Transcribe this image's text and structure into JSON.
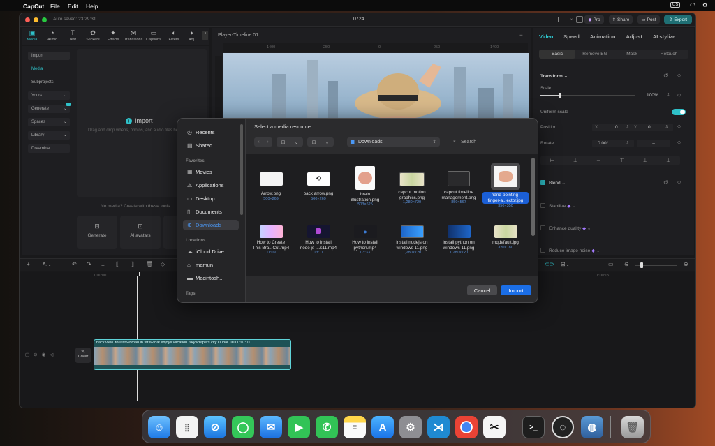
{
  "menubar": {
    "app": "CapCut",
    "items": [
      "File",
      "Edit",
      "Help"
    ],
    "input_source": "US"
  },
  "window": {
    "autosave": "Auto saved: 23:29:31",
    "title": "0724",
    "pro": "Pro",
    "share": "Share",
    "post": "Post",
    "export": "Export"
  },
  "toolbar": {
    "tools": [
      "Media",
      "Audio",
      "Text",
      "Stickers",
      "Effects",
      "Transitions",
      "Captions",
      "Filters",
      "Adj"
    ]
  },
  "leftnav": {
    "items": [
      "Import",
      "Media",
      "Subprojects",
      "Yours",
      "Generate",
      "Spaces",
      "Library",
      "Dreamina"
    ]
  },
  "media": {
    "import_label": "Import",
    "hint": "Drag and drop videos, photos, and audio files here",
    "no_media": "No media? Create with these tools",
    "generate": "Generate",
    "ai_avatars": "AI avatars"
  },
  "player": {
    "title": "Player-Timeline 01",
    "ruler": [
      "1400",
      "250",
      "0",
      "250",
      "1400"
    ]
  },
  "rightpanel": {
    "tabs": [
      "Video",
      "Speed",
      "Animation",
      "Adjust",
      "AI stylize"
    ],
    "subtabs": [
      "Basic",
      "Remove BG",
      "Mask",
      "Retouch"
    ],
    "transform": "Transform",
    "scale": "Scale",
    "scale_value": "100%",
    "uniform": "Uniform scale",
    "position": "Position",
    "pos_x_label": "X",
    "pos_x": "0",
    "pos_y_label": "Y",
    "pos_y": "0",
    "rotate": "Rotate",
    "rotate_value": "0.00°",
    "rotate_dash": "–",
    "blend": "Blend",
    "stabilize": "Stabilize",
    "enhance": "Enhance quality",
    "reduce_noise": "Reduce image noise"
  },
  "timeline": {
    "time_a": "1:00:00",
    "time_b": "1:00:15",
    "clip_label": "back view. tourist woman in straw hat enjoys vacation. skyscrapers city Dubai",
    "clip_time": "00:00:07:01",
    "cover": "Cover"
  },
  "dialog": {
    "title": "Select a media resource",
    "location": "Downloads",
    "search_placeholder": "Search",
    "cancel": "Cancel",
    "import": "Import",
    "sidebar": {
      "favorites_header": "Favorites",
      "locations_header": "Locations",
      "tags_header": "Tags",
      "top": [
        {
          "label": "Recents",
          "icon": "clock-icon"
        },
        {
          "label": "Shared",
          "icon": "shared-folder-icon"
        }
      ],
      "favorites": [
        {
          "label": "Movies",
          "icon": "film-icon"
        },
        {
          "label": "Applications",
          "icon": "apps-icon"
        },
        {
          "label": "Desktop",
          "icon": "desktop-icon"
        },
        {
          "label": "Documents",
          "icon": "document-icon"
        },
        {
          "label": "Downloads",
          "icon": "download-icon"
        }
      ],
      "locations": [
        {
          "label": "iCloud Drive",
          "icon": "cloud-icon"
        },
        {
          "label": "mamun",
          "icon": "home-icon"
        },
        {
          "label": "Macintosh...",
          "icon": "disk-icon"
        }
      ]
    },
    "files": [
      {
        "name1": "Arrow.png",
        "name2": "",
        "sub": "500×269"
      },
      {
        "name1": "back arrow.png",
        "name2": "",
        "sub": "500×269"
      },
      {
        "name1": "brain",
        "name2": "illustration.png",
        "sub": "503×625"
      },
      {
        "name1": "capcut motion",
        "name2": "graphics.png",
        "sub": "1,280×720"
      },
      {
        "name1": "capcut timeline",
        "name2": "management.png",
        "sub": "850×567"
      },
      {
        "name1": "hand-pointing-",
        "name2": "finger-a...ector.jpg",
        "sub": "350×350"
      },
      {
        "name1": "How to Create",
        "name2": "This Bra...Cut.mp4",
        "sub": "11:09"
      },
      {
        "name1": "How to install",
        "name2": "node js i...s11.mp4",
        "sub": "03:11"
      },
      {
        "name1": "How to install",
        "name2": "python.mp4",
        "sub": "03:33"
      },
      {
        "name1": "install nodejs on",
        "name2": "windows 11.png",
        "sub": "1,280×720"
      },
      {
        "name1": "install python on",
        "name2": "windows 11.png",
        "sub": "1,280×720"
      },
      {
        "name1": "mqdefault.jpg",
        "name2": "",
        "sub": "320×180"
      }
    ]
  },
  "colors": {
    "accent": "#2fc1c9",
    "selection": "#1b5fd6",
    "export_bg": "#1f6f74"
  }
}
